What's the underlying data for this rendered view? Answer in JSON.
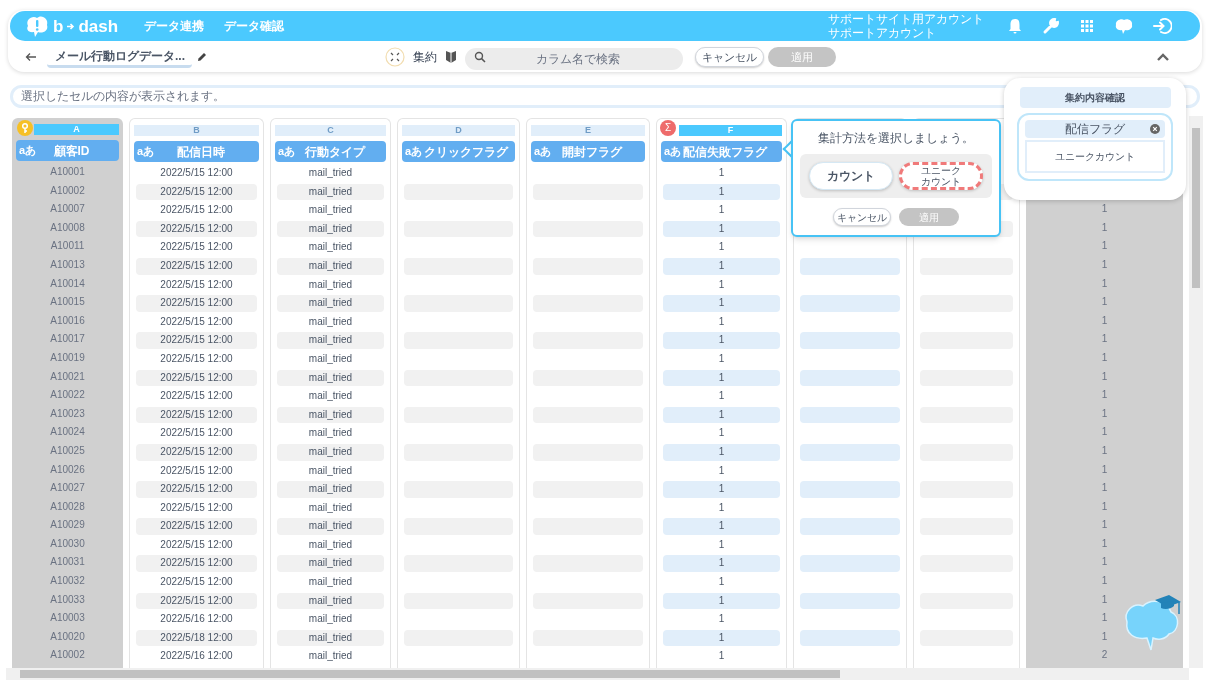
{
  "header": {
    "logo": [
      "b",
      "dash"
    ],
    "nav": [
      "データ連携",
      "データ確認"
    ],
    "account": [
      "サポートサイト用アカウント",
      "サポートアカウント"
    ]
  },
  "toolbar": {
    "title": "メール行動ログデータ...",
    "mode": "集約",
    "search_placeholder": "カラム名で検索",
    "cancel": "キャンセル",
    "apply": {
      "label": "適用",
      "disabled": true
    }
  },
  "cell_preview": {
    "placeholder": "選択したセルの内容が表示されます。"
  },
  "columns": [
    {
      "kind": "key",
      "letter": "A",
      "type": "aあ",
      "name": "顧客ID",
      "values": [
        "A10001",
        "A10002",
        "A10007",
        "A10008",
        "A10011",
        "A10013",
        "A10014",
        "A10015",
        "A10016",
        "A10017",
        "A10019",
        "A10021",
        "A10022",
        "A10023",
        "A10024",
        "A10025",
        "A10026",
        "A10027",
        "A10028",
        "A10029",
        "A10030",
        "A10031",
        "A10032",
        "A10033",
        "A10003",
        "A10020",
        "A10002"
      ]
    },
    {
      "kind": "normal",
      "letter": "B",
      "type": "aあ",
      "name": "配信日時",
      "values": [
        "2022/5/15 12:00",
        "2022/5/15 12:00",
        "2022/5/15 12:00",
        "2022/5/15 12:00",
        "2022/5/15 12:00",
        "2022/5/15 12:00",
        "2022/5/15 12:00",
        "2022/5/15 12:00",
        "2022/5/15 12:00",
        "2022/5/15 12:00",
        "2022/5/15 12:00",
        "2022/5/15 12:00",
        "2022/5/15 12:00",
        "2022/5/15 12:00",
        "2022/5/15 12:00",
        "2022/5/15 12:00",
        "2022/5/15 12:00",
        "2022/5/15 12:00",
        "2022/5/15 12:00",
        "2022/5/15 12:00",
        "2022/5/15 12:00",
        "2022/5/15 12:00",
        "2022/5/15 12:00",
        "2022/5/15 12:00",
        "2022/5/16 12:00",
        "2022/5/18 12:00",
        "2022/5/16 12:00"
      ]
    },
    {
      "kind": "normal",
      "letter": "C",
      "type": "aあ",
      "name": "行動タイプ",
      "values": [
        "mail_tried",
        "mail_tried",
        "mail_tried",
        "mail_tried",
        "mail_tried",
        "mail_tried",
        "mail_tried",
        "mail_tried",
        "mail_tried",
        "mail_tried",
        "mail_tried",
        "mail_tried",
        "mail_tried",
        "mail_tried",
        "mail_tried",
        "mail_tried",
        "mail_tried",
        "mail_tried",
        "mail_tried",
        "mail_tried",
        "mail_tried",
        "mail_tried",
        "mail_tried",
        "mail_tried",
        "mail_tried",
        "mail_tried",
        "mail_tried"
      ]
    },
    {
      "kind": "normal",
      "letter": "D",
      "type": "aあ",
      "name": "クリックフラグ"
    },
    {
      "kind": "normal",
      "letter": "E",
      "type": "aあ",
      "name": "開封フラグ"
    },
    {
      "kind": "aggregate",
      "badge": "Σ",
      "letter": "F",
      "type": "aあ",
      "name": "配信失敗フラグ",
      "values": [
        "1",
        "1",
        "1",
        "1",
        "1",
        "1",
        "1",
        "1",
        "1",
        "1",
        "1",
        "1",
        "1",
        "1",
        "1",
        "1",
        "1",
        "1",
        "1",
        "1",
        "1",
        "1",
        "1",
        "1",
        "1",
        "1",
        "1"
      ]
    },
    {
      "kind": "covered_blue"
    },
    {
      "kind": "covered"
    },
    {
      "kind": "result",
      "values": [
        "1",
        "1",
        "1",
        "1",
        "1",
        "1",
        "1",
        "1",
        "1",
        "1",
        "1",
        "1",
        "1",
        "1",
        "1",
        "1",
        "1",
        "1",
        "1",
        "1",
        "1",
        "1",
        "1",
        "1",
        "2"
      ]
    }
  ],
  "aggregate_popup": {
    "title": "集計方法を選択しましょう。",
    "options": [
      {
        "label": "カウント",
        "highlighted": false
      },
      {
        "lines": [
          "ユニーク",
          "カウント"
        ],
        "highlighted": true
      }
    ],
    "cancel": "キャンセル",
    "apply": {
      "label": "適用",
      "disabled": true
    }
  },
  "summary_panel": {
    "title": "集約内容確認",
    "items": [
      {
        "column": "配信フラグ",
        "method": "ユニークカウント"
      }
    ]
  }
}
